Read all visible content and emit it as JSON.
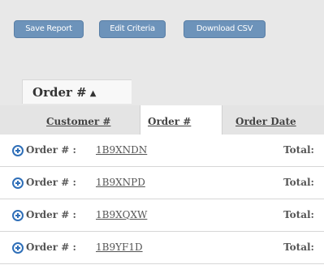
{
  "toolbar": {
    "save_label": "Save Report",
    "edit_label": "Edit Criteria",
    "csv_label": "Download CSV"
  },
  "grouping": {
    "label": "Order #",
    "sort_arrow": "▲"
  },
  "columns": {
    "customer": "Customer #",
    "order": "Order #",
    "date": "Order Date"
  },
  "rows": [
    {
      "label": "Order # :",
      "order": "1B9XNDN",
      "total": "Total:"
    },
    {
      "label": "Order # :",
      "order": "1B9XNPD",
      "total": "Total:"
    },
    {
      "label": "Order # :",
      "order": "1B9XQXW",
      "total": "Total:"
    },
    {
      "label": "Order # :",
      "order": "1B9YF1D",
      "total": "Total:"
    }
  ],
  "colors": {
    "button": "#6d93ba",
    "expand_icon": "#2f6fb8",
    "panel": "#e8e8e8"
  },
  "icons": {
    "expand": "plus-circle-icon",
    "sort": "sort-ascending-icon"
  }
}
